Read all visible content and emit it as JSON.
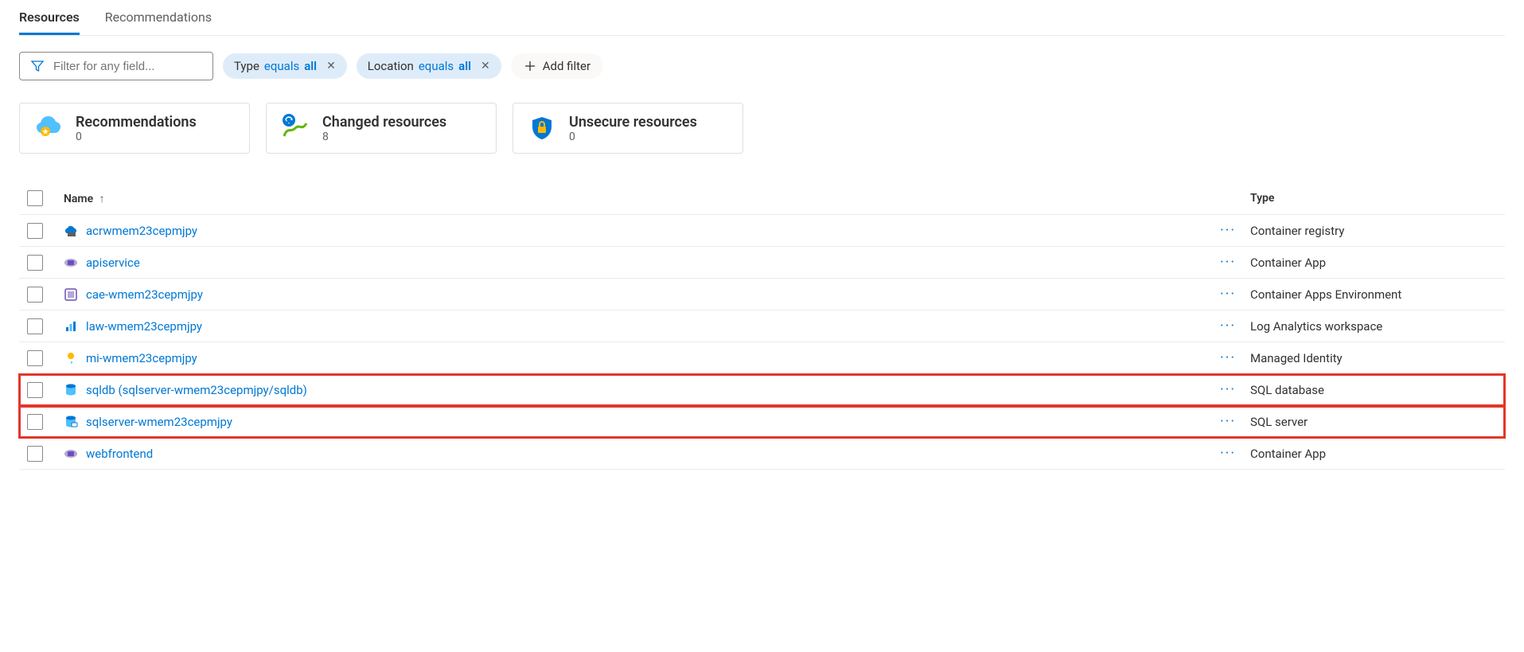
{
  "tabs": {
    "resources": "Resources",
    "recommendations": "Recommendations"
  },
  "filters": {
    "placeholder": "Filter for any field...",
    "type_word": "Type",
    "location_word": "Location",
    "equals_word": "equals",
    "all_word": "all",
    "add_filter": "Add filter"
  },
  "cards": {
    "recommendations": {
      "title": "Recommendations",
      "count": "0"
    },
    "changed": {
      "title": "Changed resources",
      "count": "8"
    },
    "unsecure": {
      "title": "Unsecure resources",
      "count": "0"
    }
  },
  "table": {
    "headers": {
      "name": "Name",
      "type": "Type"
    },
    "rows": [
      {
        "name": "acrwmem23cepmjpy",
        "type": "Container registry",
        "icon": "container-registry",
        "highlighted": false
      },
      {
        "name": "apiservice",
        "type": "Container App",
        "icon": "container-app",
        "highlighted": false
      },
      {
        "name": "cae-wmem23cepmjpy",
        "type": "Container Apps Environment",
        "icon": "container-apps-env",
        "highlighted": false
      },
      {
        "name": "law-wmem23cepmjpy",
        "type": "Log Analytics workspace",
        "icon": "log-analytics",
        "highlighted": false
      },
      {
        "name": "mi-wmem23cepmjpy",
        "type": "Managed Identity",
        "icon": "managed-identity",
        "highlighted": false
      },
      {
        "name": "sqldb (sqlserver-wmem23cepmjpy/sqldb)",
        "type": "SQL database",
        "icon": "sql-database",
        "highlighted": true
      },
      {
        "name": "sqlserver-wmem23cepmjpy",
        "type": "SQL server",
        "icon": "sql-server",
        "highlighted": true
      },
      {
        "name": "webfrontend",
        "type": "Container App",
        "icon": "container-app",
        "highlighted": false
      }
    ]
  },
  "more_glyph": "···"
}
